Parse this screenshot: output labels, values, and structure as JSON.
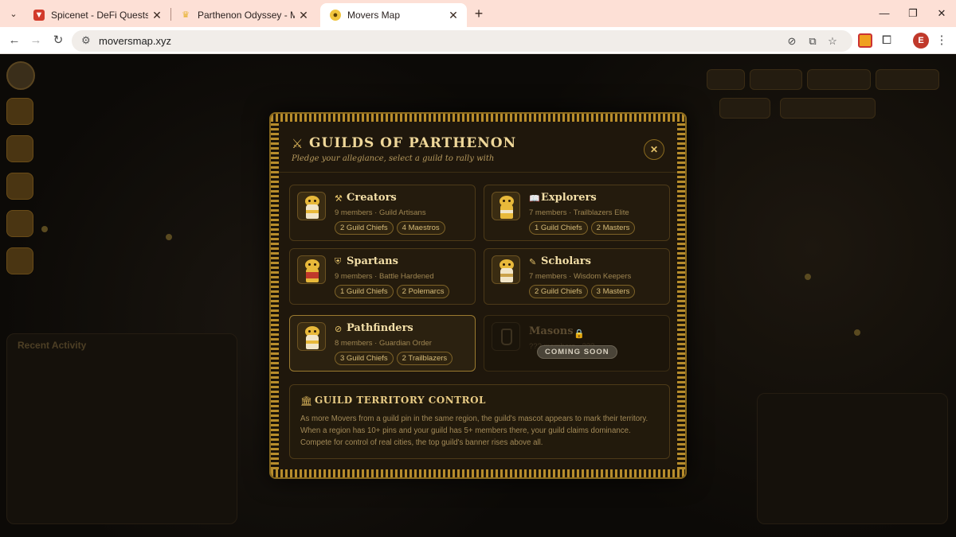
{
  "browser": {
    "tabs": [
      {
        "title": "Spicenet - DeFi Quests & Challe",
        "favicon_color": "#d23a2b"
      },
      {
        "title": "Parthenon Odyssey - Movemen",
        "favicon_color": "#e7b02a"
      },
      {
        "title": "Movers Map",
        "favicon_color": "#f0c43c"
      }
    ],
    "url": "moversmap.xyz",
    "profile_initial": "E",
    "tab_menu_glyph": "⌄",
    "new_tab_glyph": "+",
    "close_glyph": "✕",
    "window_controls": {
      "minimize": "—",
      "maximize": "❐",
      "close": "✕"
    },
    "nav_glyphs": {
      "back": "←",
      "forward": "→",
      "reload": "↻",
      "site_info": "⚙",
      "menu": "⋮"
    },
    "omnibox_icons": {
      "eye_off": "⊘",
      "install": "⧉",
      "bookmark": "☆",
      "extensions": "⧠"
    }
  },
  "modal": {
    "icon": "⚔",
    "title": "GUILDS OF PARTHENON",
    "subtitle": "Pledge your allegiance, select a guild to rally with",
    "close_glyph": "✕",
    "guilds": [
      {
        "icon": "⚒",
        "name": "Creators",
        "meta": "9 members · Guild Artisans",
        "badges": [
          "2 Guild Chiefs",
          "4 Maestros"
        ],
        "accent": "#e8b93a",
        "selected": false
      },
      {
        "icon": "📖",
        "name": "Explorers",
        "meta": "7 members · Trailblazers Elite",
        "badges": [
          "1 Guild Chiefs",
          "2 Masters"
        ],
        "accent": "#e8b93a",
        "selected": false
      },
      {
        "icon": "⛨",
        "name": "Spartans",
        "meta": "9 members · Battle Hardened",
        "badges": [
          "1 Guild Chiefs",
          "2 Polemarcs"
        ],
        "accent": "#c0392b",
        "selected": false
      },
      {
        "icon": "✎",
        "name": "Scholars",
        "meta": "7 members · Wisdom Keepers",
        "badges": [
          "2 Guild Chiefs",
          "3 Masters"
        ],
        "accent": "#e8b93a",
        "selected": false
      },
      {
        "icon": "⊘",
        "name": "Pathfinders",
        "meta": "8 members · Guardian Order",
        "badges": [
          "3 Guild Chiefs",
          "2 Trailblazers"
        ],
        "accent": "#e8b93a",
        "selected": true
      }
    ],
    "locked_guild": {
      "name": "Masons",
      "meta": "??? members · ???",
      "lock_glyph": "🔒",
      "status": "COMING SOON"
    },
    "territory": {
      "icon": "🏛",
      "title": "GUILD TERRITORY CONTROL",
      "text": "As more Movers from a guild pin in the same region, the guild's mascot appears to mark their territory. When a region has 10+ pins and your guild has 5+ members there, your guild claims dominance. Compete for control of real cities, the top guild's banner rises above all."
    }
  },
  "background": {
    "sidebar_items": 5,
    "section_label": "Recent Activity"
  }
}
